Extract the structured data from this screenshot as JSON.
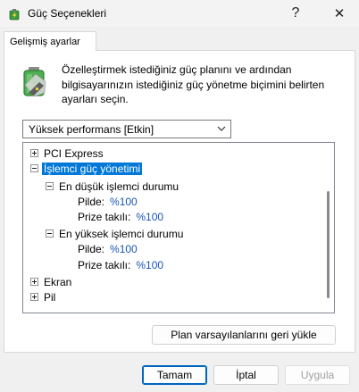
{
  "window": {
    "title": "Güç Seçenekleri",
    "help_glyph": "?",
    "close_glyph": "✕"
  },
  "tab": {
    "label": "Gelişmiş ayarlar"
  },
  "description": "Özelleştirmek istediğiniz güç planını ve ardından bilgisayarınızın istediğiniz güç yönetme biçimini belirten ayarları seçin.",
  "plan_select": {
    "value": "Yüksek performans [Etkin]"
  },
  "tree": {
    "pci_express": "PCI Express",
    "processor_power": "İşlemci güç yönetimi",
    "min_state": "En düşük işlemci durumu",
    "min_battery_label": "Pilde:",
    "min_battery_value": "%100",
    "min_plugged_label": "Prize takılı:",
    "min_plugged_value": "%100",
    "max_state": "En yüksek işlemci durumu",
    "max_battery_label": "Pilde:",
    "max_battery_value": "%100",
    "max_plugged_label": "Prize takılı:",
    "max_plugged_value": "%100",
    "display": "Ekran",
    "battery": "Pil"
  },
  "buttons": {
    "restore": "Plan varsayılanlarını geri yükle",
    "ok": "Tamam",
    "cancel": "İptal",
    "apply": "Uygula"
  },
  "colors": {
    "accent": "#0078d7",
    "value_text": "#1a55b5"
  }
}
